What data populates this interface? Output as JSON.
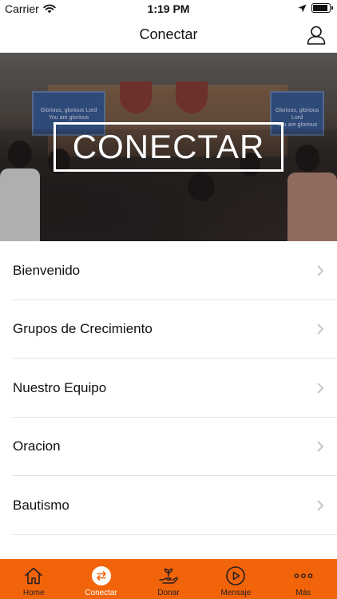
{
  "status_bar": {
    "carrier": "Carrier",
    "time": "1:19 PM",
    "battery_level": 0.9
  },
  "nav": {
    "title": "Conectar",
    "profile_icon": "person-icon"
  },
  "hero": {
    "title": "CONECTAR",
    "screen_left_lines": [
      "Glorious, glorious Lord",
      "You are glorious"
    ],
    "screen_right_lines": [
      "Glorious, glorious Lord",
      "You are glorious"
    ]
  },
  "menu": {
    "items": [
      {
        "label": "Bienvenido"
      },
      {
        "label": "Grupos de Crecimiento"
      },
      {
        "label": "Nuestro Equipo"
      },
      {
        "label": "Oracion"
      },
      {
        "label": "Bautismo"
      }
    ]
  },
  "tabs": {
    "items": [
      {
        "label": "Home",
        "icon": "home-icon",
        "active": false
      },
      {
        "label": "Conectar",
        "icon": "swap-arrows-icon",
        "active": true
      },
      {
        "label": "Donar",
        "icon": "hand-plant-icon",
        "active": false
      },
      {
        "label": "Mensaje",
        "icon": "play-circle-icon",
        "active": false
      },
      {
        "label": "Más",
        "icon": "more-dots-icon",
        "active": false
      }
    ]
  },
  "colors": {
    "accent": "#f2640a",
    "text": "#111111",
    "separator": "#e2e2e2"
  }
}
